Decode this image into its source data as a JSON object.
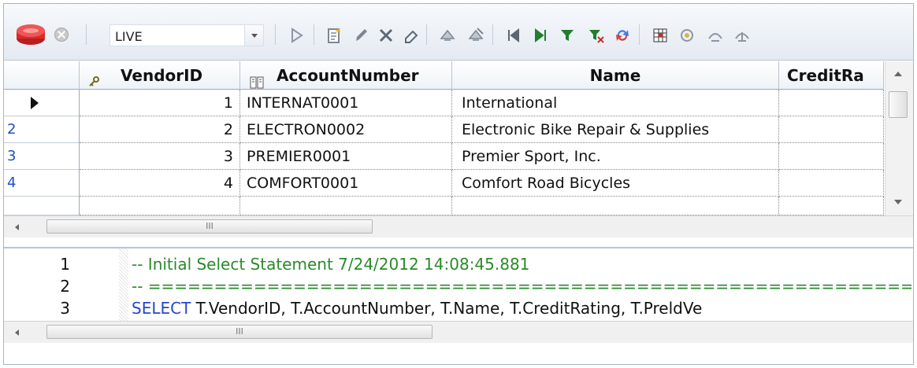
{
  "toolbar": {
    "combo_value": "LIVE",
    "icons": [
      "database-icon",
      "stop-icon",
      "play-icon",
      "new-record-icon",
      "edit-icon",
      "delete-icon",
      "eraser-icon",
      "post-icon",
      "cancel-post-icon",
      "first-record-icon",
      "last-record-icon",
      "filter-icon",
      "filter-clear-icon",
      "refresh-icon",
      "grid-view-icon",
      "settings-icon",
      "expand-icon",
      "collapse-icon"
    ]
  },
  "grid": {
    "columns": [
      "VendorID",
      "AccountNumber",
      "Name",
      "CreditRa"
    ],
    "rows": [
      {
        "num": "",
        "id": "1",
        "account": "INTERNAT0001",
        "name": "International"
      },
      {
        "num": "2",
        "id": "2",
        "account": "ELECTRON0002",
        "name": "Electronic Bike Repair & Supplies"
      },
      {
        "num": "3",
        "id": "3",
        "account": "PREMIER0001",
        "name": "Premier Sport, Inc."
      },
      {
        "num": "4",
        "id": "4",
        "account": "COMFORT0001",
        "name": "Comfort Road Bicycles"
      }
    ],
    "scroll_mark": "III"
  },
  "editor": {
    "lines": [
      {
        "num": "1",
        "text": "-- Initial Select Statement 7/24/2012 14:08:45.881",
        "kind": "comment"
      },
      {
        "num": "2",
        "text": "-- ==================================================================",
        "kind": "comment"
      },
      {
        "num": "3",
        "keyword": "SELECT",
        "text": " T.VendorID, T.AccountNumber, T.Name, T.CreditRating, T.PreldVe",
        "kind": "code"
      }
    ],
    "scroll_mark": "III"
  },
  "colors": {
    "comment": "#2a8a2a",
    "keyword": "#2647c9",
    "row_number": "#1c50c4"
  }
}
